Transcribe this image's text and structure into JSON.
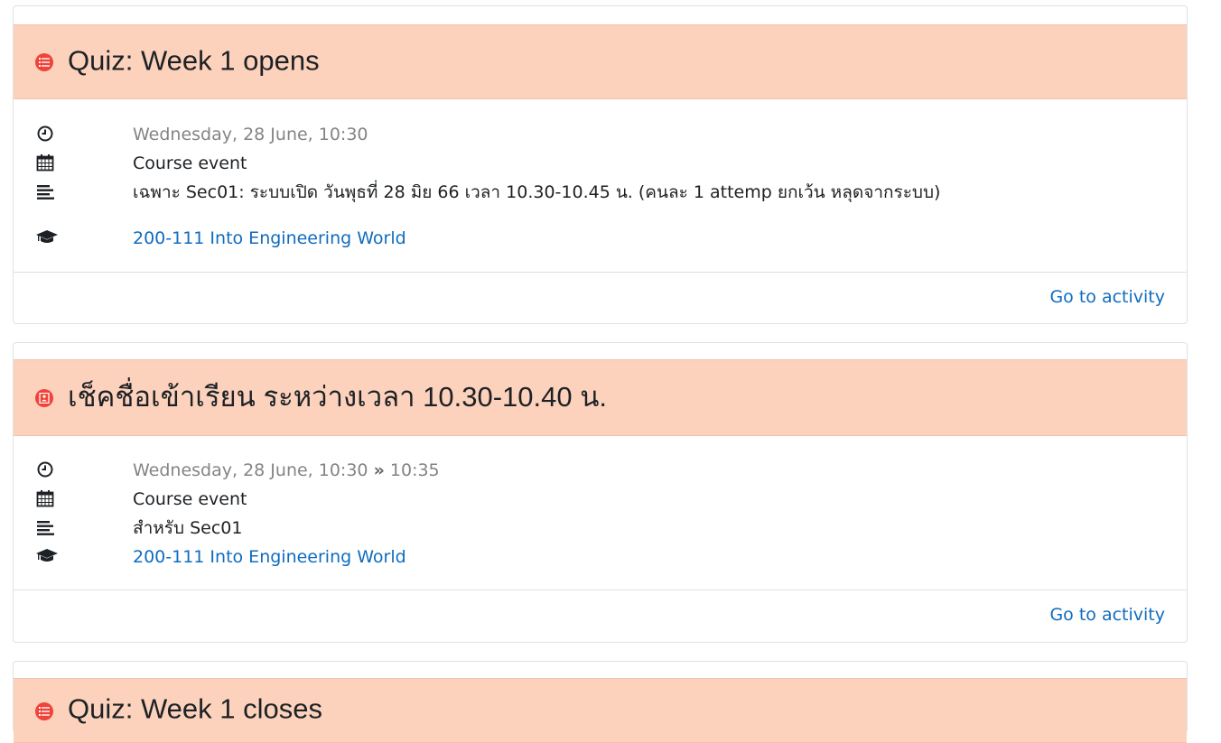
{
  "events": [
    {
      "title": "Quiz: Week 1 opens",
      "icon": "quiz-icon",
      "date": "Wednesday, 28 June, 10:30",
      "date_end": "",
      "type": "Course event",
      "description": "เฉพาะ Sec01: ระบบเปิด วันพุธที่ 28 มิย 66 เวลา 10.30-10.45 น. (คนละ 1 attemp ยกเว้น หลุดจากระบบ)",
      "course": "200-111 Into Engineering World",
      "action": "Go to activity"
    },
    {
      "title": "เช็คชื่อเข้าเรียน ระหว่างเวลา 10.30-10.40 น.",
      "icon": "attendance-icon",
      "date": "Wednesday, 28 June, 10:30",
      "date_sep": "»",
      "date_end": "10:35",
      "type": "Course event",
      "description": "สำหรับ Sec01",
      "course": "200-111 Into Engineering World",
      "action": "Go to activity"
    },
    {
      "title": "Quiz: Week 1 closes",
      "icon": "quiz-icon"
    }
  ],
  "colors": {
    "header_bg": "#fdd2bc",
    "icon_bg": "#f0433a",
    "link": "#0f6cbf",
    "muted": "#848484"
  }
}
